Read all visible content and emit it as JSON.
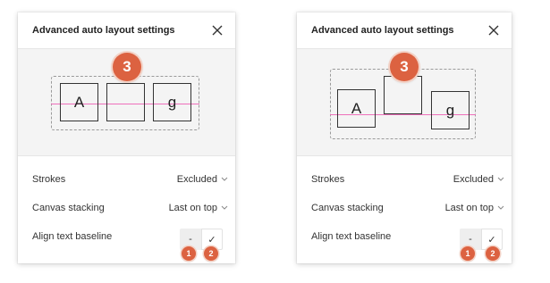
{
  "panels": [
    {
      "title": "Advanced auto layout settings",
      "preview": {
        "step": "3",
        "boxes": [
          "A",
          "",
          "g"
        ]
      },
      "rows": [
        {
          "label": "Strokes",
          "value": "Excluded"
        },
        {
          "label": "Canvas stacking",
          "value": "Last on top"
        }
      ],
      "baseline_row": {
        "label": "Align text baseline",
        "off_label": "-",
        "on_label": "✓"
      },
      "steps": [
        "1",
        "2"
      ]
    },
    {
      "title": "Advanced auto layout settings",
      "preview": {
        "step": "3",
        "boxes": [
          "A",
          "",
          "g"
        ]
      },
      "rows": [
        {
          "label": "Strokes",
          "value": "Excluded"
        },
        {
          "label": "Canvas stacking",
          "value": "Last on top"
        }
      ],
      "baseline_row": {
        "label": "Align text baseline",
        "off_label": "-",
        "on_label": "✓"
      },
      "steps": [
        "1",
        "2"
      ]
    }
  ],
  "colors": {
    "step_badge": "#dc6241",
    "baseline_guide": "#ee6fbb",
    "preview_bg": "#f4f4f4"
  }
}
